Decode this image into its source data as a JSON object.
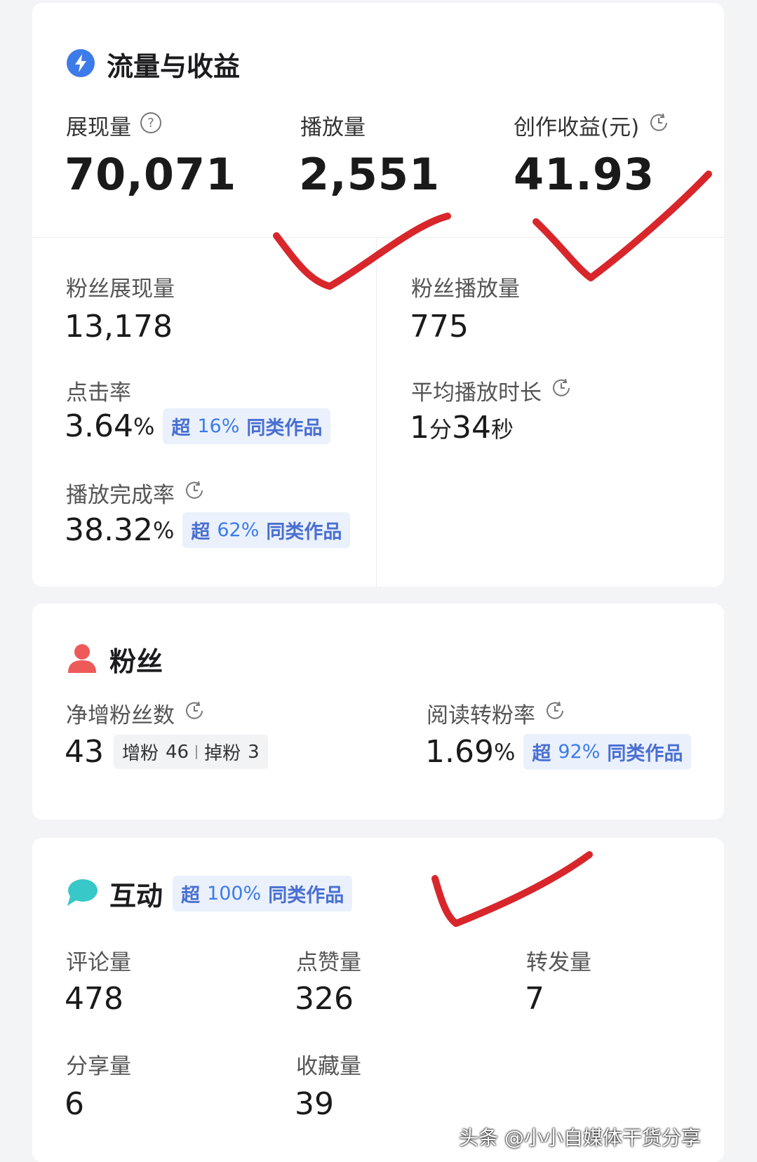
{
  "traffic": {
    "title": "流量与收益",
    "impressions": {
      "label": "展现量",
      "value": "70,071"
    },
    "plays": {
      "label": "播放量",
      "value": "2,551"
    },
    "earnings": {
      "label": "创作收益(元)",
      "value": "41.93"
    },
    "fan_impressions": {
      "label": "粉丝展现量",
      "value": "13,178"
    },
    "fan_plays": {
      "label": "粉丝播放量",
      "value": "775"
    },
    "ctr": {
      "label": "点击率",
      "value": "3.64",
      "unit": "%",
      "badge_prefix": "超",
      "badge_pct": "16%",
      "badge_suffix": "同类作品"
    },
    "avg_duration": {
      "label": "平均播放时长",
      "min": "1",
      "min_unit": "分",
      "sec": "34",
      "sec_unit": "秒"
    },
    "completion": {
      "label": "播放完成率",
      "value": "38.32",
      "unit": "%",
      "badge_prefix": "超",
      "badge_pct": "62%",
      "badge_suffix": "同类作品"
    }
  },
  "fans": {
    "title": "粉丝",
    "net_gain": {
      "label": "净增粉丝数",
      "value": "43",
      "gain_label": "增粉",
      "gain": "46",
      "loss_label": "掉粉",
      "loss": "3"
    },
    "convert": {
      "label": "阅读转粉率",
      "value": "1.69",
      "unit": "%",
      "badge_prefix": "超",
      "badge_pct": "92%",
      "badge_suffix": "同类作品"
    }
  },
  "interaction": {
    "title": "互动",
    "badge_prefix": "超",
    "badge_pct": "100%",
    "badge_suffix": "同类作品",
    "comments": {
      "label": "评论量",
      "value": "478"
    },
    "likes": {
      "label": "点赞量",
      "value": "326"
    },
    "reposts": {
      "label": "转发量",
      "value": "7"
    },
    "shares": {
      "label": "分享量",
      "value": "6"
    },
    "favorites": {
      "label": "收藏量",
      "value": "39"
    }
  },
  "watermark": "头条 @小小自媒体干货分享",
  "colors": {
    "accent_blue": "#3d7be8",
    "fan_red": "#ee5a5a",
    "chat_teal": "#38c8c8",
    "check_red": "#d8262b"
  },
  "icons": {
    "traffic": "lightning-drop-icon",
    "fans": "person-icon",
    "interaction": "chat-bubble-icon",
    "help": "question-circle-icon",
    "history": "clock-refresh-icon"
  }
}
